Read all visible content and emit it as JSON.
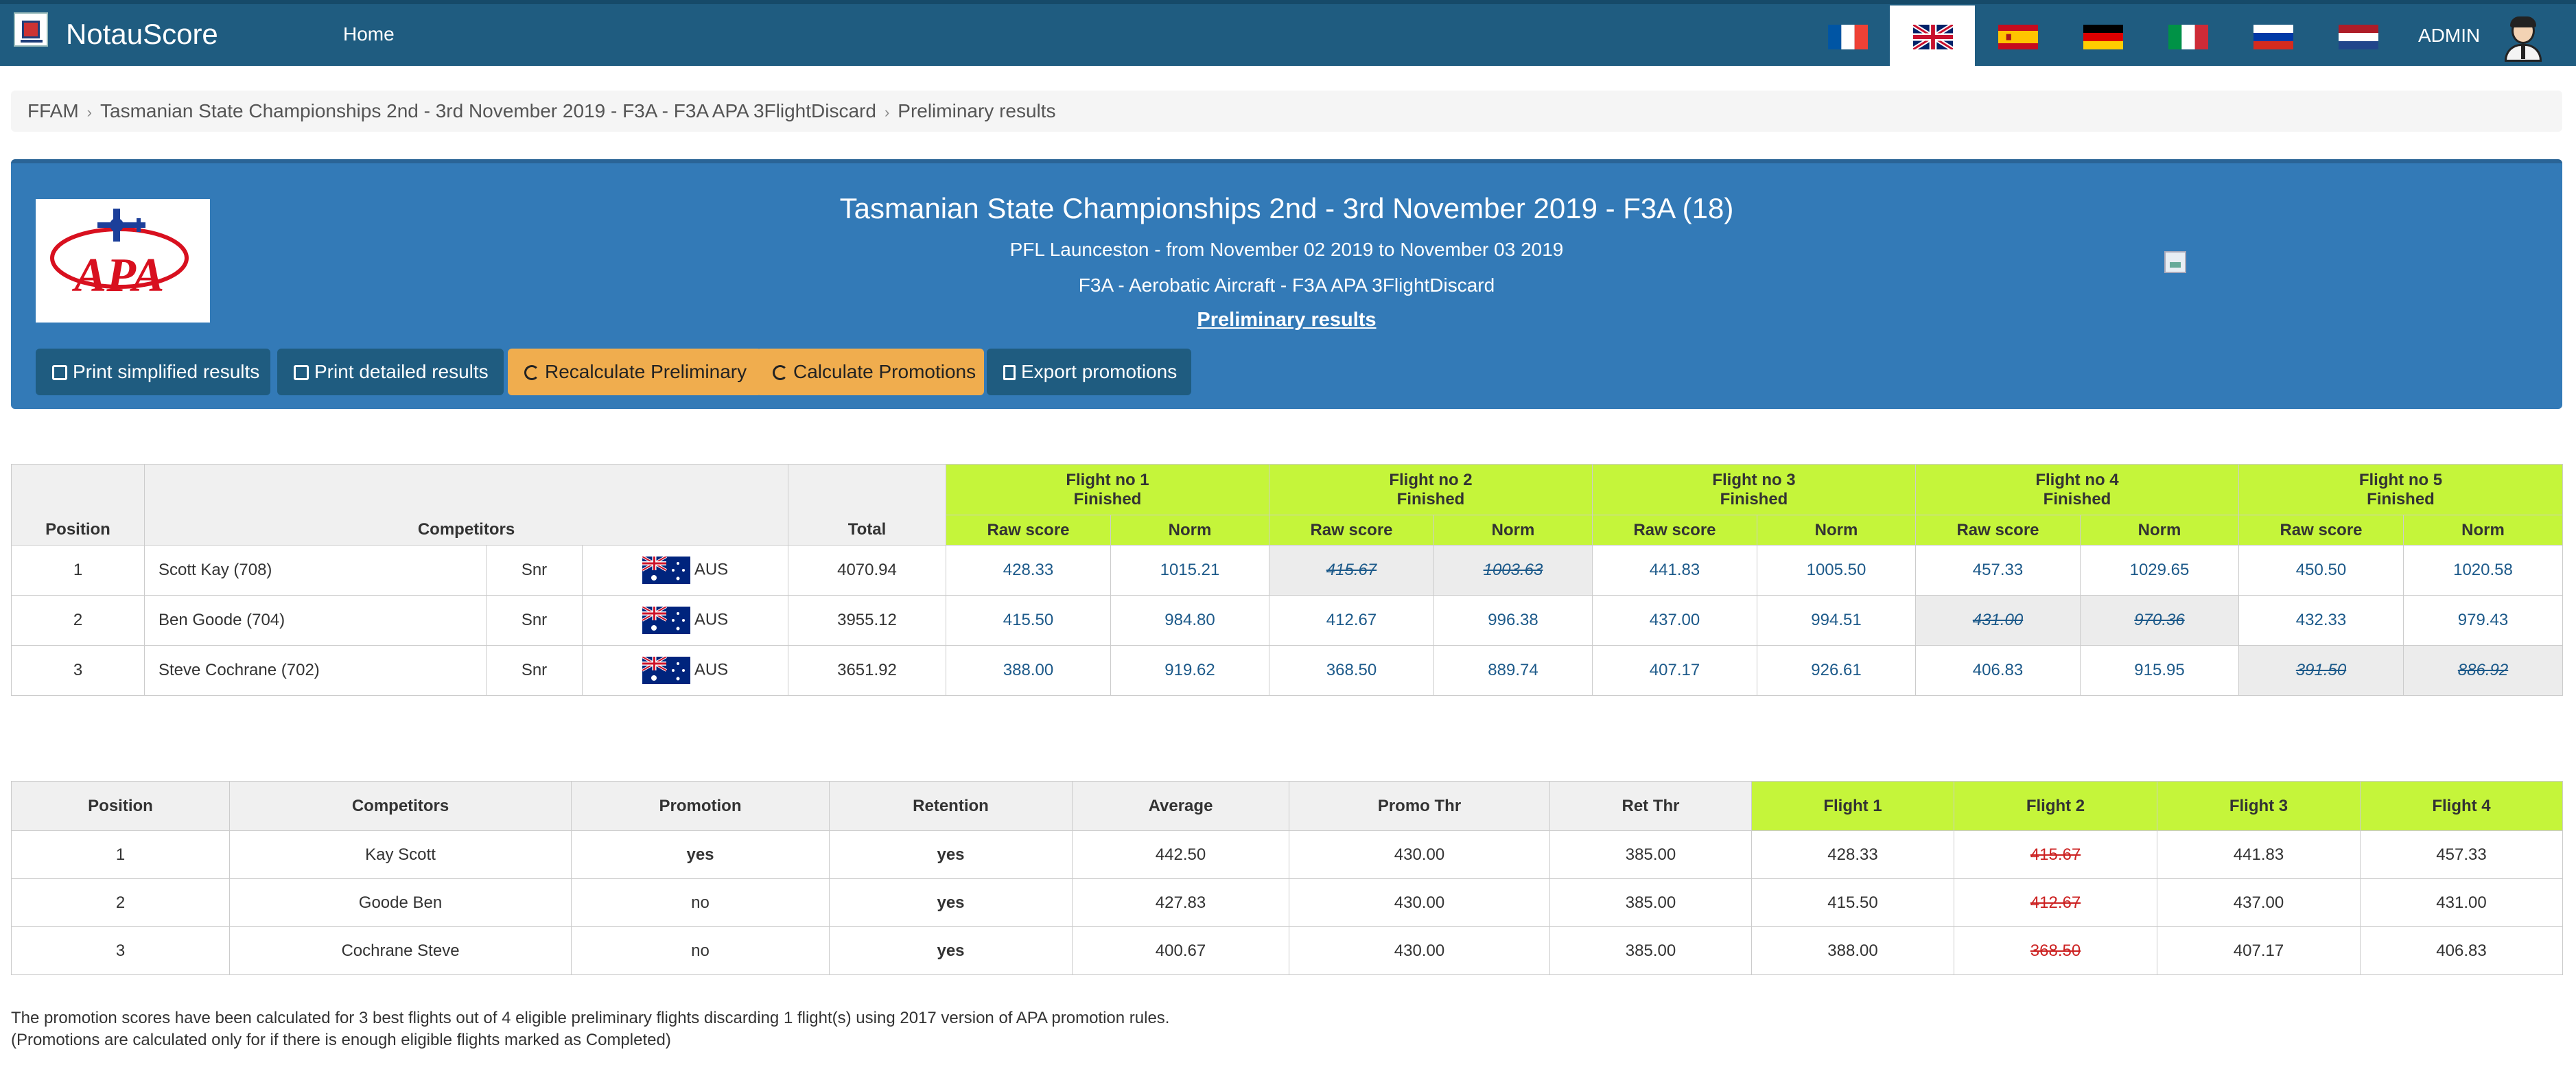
{
  "navbar": {
    "brand": "NotauScore",
    "home": "Home",
    "admin": "ADMIN",
    "languages": [
      "fr-flag-icon",
      "uk-flag-icon",
      "es-flag-icon",
      "de-flag-icon",
      "it-flag-icon",
      "ru-flag-icon",
      "nl-flag-icon"
    ],
    "active_language": "uk-flag-icon"
  },
  "breadcrumb": [
    "FFAM",
    "Tasmanian State Championships 2nd - 3rd November 2019 - F3A - F3A APA 3FlightDiscard",
    "Preliminary results"
  ],
  "header": {
    "title": "Tasmanian State Championships 2nd - 3rd November 2019 - F3A (18)",
    "location": "PFL Launceston - from November 02 2019 to November 03 2019",
    "category": "F3A - Aerobatic Aircraft - F3A APA 3FlightDiscard",
    "status": "Preliminary results",
    "logo_text": "APA",
    "buttons": {
      "print_simplified": "Print simplified results",
      "print_detailed": "Print detailed results",
      "recalculate": "Recalculate Preliminary",
      "calc_promotions": "Calculate Promotions",
      "export": "Export promotions"
    }
  },
  "results": {
    "headers": {
      "position": "Position",
      "competitors": "Competitors",
      "total": "Total",
      "raw": "Raw score",
      "norm": "Norm"
    },
    "flights": [
      {
        "name": "Flight no 1",
        "status": "Finished"
      },
      {
        "name": "Flight no 2",
        "status": "Finished"
      },
      {
        "name": "Flight no 3",
        "status": "Finished"
      },
      {
        "name": "Flight no 4",
        "status": "Finished"
      },
      {
        "name": "Flight no 5",
        "status": "Finished"
      }
    ],
    "rows": [
      {
        "pos": "1",
        "name": "Scott Kay (708)",
        "cls": "Snr",
        "country": "AUS",
        "total": "4070.94",
        "scores": [
          [
            "428.33",
            "1015.21"
          ],
          [
            "415.67",
            "1003.63"
          ],
          [
            "441.83",
            "1005.50"
          ],
          [
            "457.33",
            "1029.65"
          ],
          [
            "450.50",
            "1020.58"
          ]
        ],
        "discard": 1
      },
      {
        "pos": "2",
        "name": "Ben Goode (704)",
        "cls": "Snr",
        "country": "AUS",
        "total": "3955.12",
        "scores": [
          [
            "415.50",
            "984.80"
          ],
          [
            "412.67",
            "996.38"
          ],
          [
            "437.00",
            "994.51"
          ],
          [
            "431.00",
            "970.36"
          ],
          [
            "432.33",
            "979.43"
          ]
        ],
        "discard": 3
      },
      {
        "pos": "3",
        "name": "Steve Cochrane (702)",
        "cls": "Snr",
        "country": "AUS",
        "total": "3651.92",
        "scores": [
          [
            "388.00",
            "919.62"
          ],
          [
            "368.50",
            "889.74"
          ],
          [
            "407.17",
            "926.61"
          ],
          [
            "406.83",
            "915.95"
          ],
          [
            "391.50",
            "886.92"
          ]
        ],
        "discard": 4
      }
    ]
  },
  "promotions": {
    "headers": [
      "Position",
      "Competitors",
      "Promotion",
      "Retention",
      "Average",
      "Promo Thr",
      "Ret Thr",
      "Flight 1",
      "Flight 2",
      "Flight 3",
      "Flight 4"
    ],
    "rows": [
      {
        "pos": "1",
        "name": "Kay Scott",
        "promotion": "yes",
        "retention": "yes",
        "avg": "442.50",
        "promo_thr": "430.00",
        "ret_thr": "385.00",
        "f1": "428.33",
        "f2": "415.67",
        "f3": "441.83",
        "f4": "457.33"
      },
      {
        "pos": "2",
        "name": "Goode Ben",
        "promotion": "no",
        "retention": "yes",
        "avg": "427.83",
        "promo_thr": "430.00",
        "ret_thr": "385.00",
        "f1": "415.50",
        "f2": "412.67",
        "f3": "437.00",
        "f4": "431.00"
      },
      {
        "pos": "3",
        "name": "Cochrane Steve",
        "promotion": "no",
        "retention": "yes",
        "avg": "400.67",
        "promo_thr": "430.00",
        "ret_thr": "385.00",
        "f1": "388.00",
        "f2": "368.50",
        "f3": "407.17",
        "f4": "406.83"
      }
    ]
  },
  "footnote": {
    "line1": "The promotion scores have been calculated for 3 best flights out of 4 eligible preliminary flights discarding 1 flight(s) using 2017 version of APA promotion rules.",
    "line2": "(Promotions are calculated only for if there is enough eligible flights marked as Completed)"
  },
  "colors": {
    "navbar": "#1f5c80",
    "panel": "#337ab7",
    "flight_header": "#c5f53a",
    "warning_button": "#f0ad4e"
  }
}
